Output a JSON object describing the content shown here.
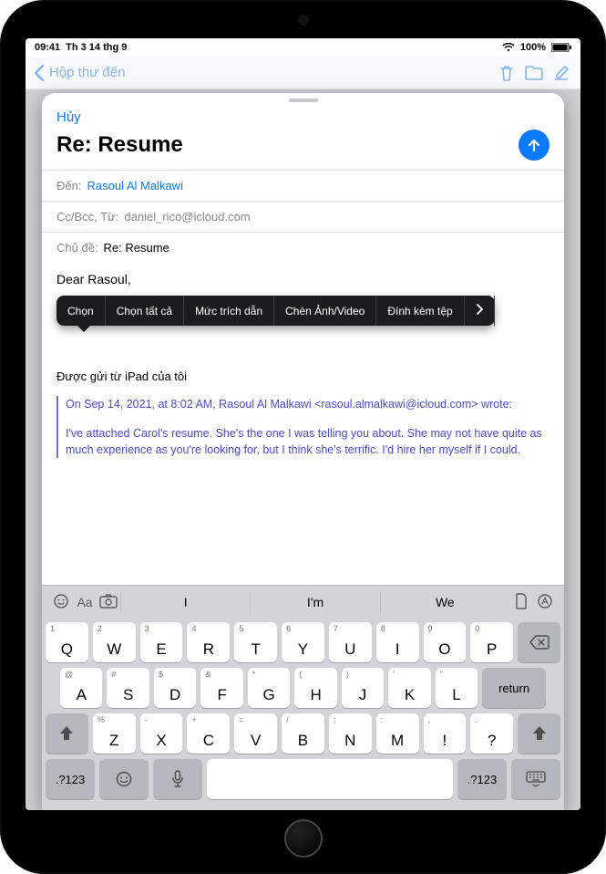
{
  "status": {
    "time": "09:41",
    "date": "Th 3 14 thg 9",
    "batt": "100%"
  },
  "nav": {
    "back": "Hộp thư đến"
  },
  "compose": {
    "cancel": "Hủy",
    "subjectTitle": "Re: Resume",
    "toLabel": "Đến:",
    "toValue": "Rasoul Al Malkawi",
    "ccLabel": "Cc/Bcc, Từ:",
    "ccValue": "daniel_rico@icloud.com",
    "subjLabel": "Chủ đề:",
    "subjValue": "Re: Resume",
    "greeting": "Dear Rasoul,",
    "signature": "Được gửi từ iPad của tôi",
    "quoteHeader": "On Sep 14, 2021, at 8:02 AM, Rasoul Al Malkawi <rasoul.almalkawi@icloud.com> wrote:",
    "quoteBody": "I've attached Carol's resume. She's the one I was telling you about. She may not have quite as much experience as you're looking for, but I think she's terrific. I'd hire her myself if I could."
  },
  "editMenu": {
    "select": "Chọn",
    "selectAll": "Chọn tất cả",
    "quoteLevel": "Mức trích dẫn",
    "insertMedia": "Chèn Ảnh/Video",
    "attach": "Đính kèm tệp"
  },
  "keyboard": {
    "sug1": "I",
    "sug2": "I'm",
    "sug3": "We",
    "row1": [
      {
        "m": "Q",
        "a": "1"
      },
      {
        "m": "W",
        "a": "2"
      },
      {
        "m": "E",
        "a": "3"
      },
      {
        "m": "R",
        "a": "4"
      },
      {
        "m": "T",
        "a": "5"
      },
      {
        "m": "Y",
        "a": "6"
      },
      {
        "m": "U",
        "a": "7"
      },
      {
        "m": "I",
        "a": "8"
      },
      {
        "m": "O",
        "a": "9"
      },
      {
        "m": "P",
        "a": "0"
      }
    ],
    "row2": [
      {
        "m": "A",
        "a": "@"
      },
      {
        "m": "S",
        "a": "#"
      },
      {
        "m": "D",
        "a": "$"
      },
      {
        "m": "F",
        "a": "&"
      },
      {
        "m": "G",
        "a": "*"
      },
      {
        "m": "H",
        "a": "("
      },
      {
        "m": "J",
        "a": ")"
      },
      {
        "m": "K",
        "a": "'"
      },
      {
        "m": "L",
        "a": "\""
      }
    ],
    "row3": [
      {
        "m": "Z",
        "a": "%"
      },
      {
        "m": "X",
        "a": "-"
      },
      {
        "m": "C",
        "a": "+"
      },
      {
        "m": "V",
        "a": "="
      },
      {
        "m": "B",
        "a": "/"
      },
      {
        "m": "N",
        "a": ";"
      },
      {
        "m": "M",
        "a": ":"
      },
      {
        "m": "!",
        "a": ","
      },
      {
        "m": "?",
        "a": "."
      }
    ],
    "numKey": ".?123",
    "returnKey": "return"
  }
}
